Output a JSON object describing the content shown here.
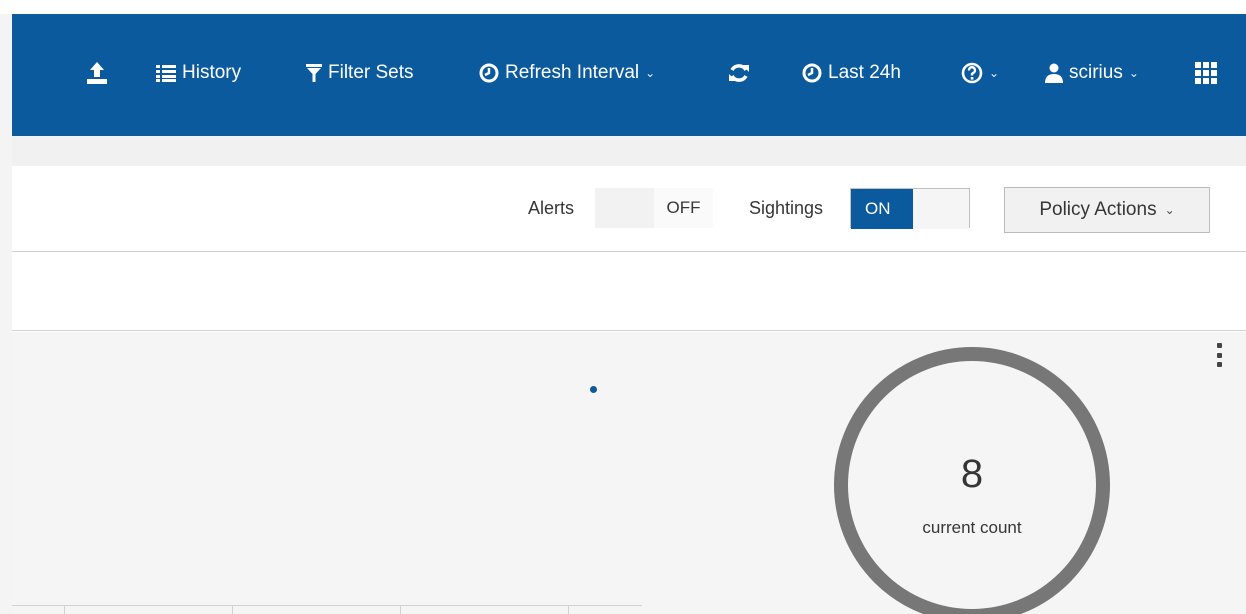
{
  "topbar": {
    "history_label": "History",
    "filter_sets_label": "Filter Sets",
    "refresh_interval_label": "Refresh Interval",
    "time_range_label": "Last 24h",
    "user_label": "scirius",
    "background_color": "#0b5a9e"
  },
  "toolbar": {
    "alerts_label": "Alerts",
    "alerts_state": "OFF",
    "sightings_label": "Sightings",
    "sightings_state": "ON",
    "policy_actions_label": "Policy Actions"
  },
  "widget": {
    "count_value": "8",
    "count_label": "current count"
  },
  "icons": [
    "upload-icon",
    "list-icon",
    "filter-icon",
    "clock-icon",
    "refresh-icon",
    "help-icon",
    "user-icon",
    "apps-grid-icon",
    "kebab-menu-icon"
  ]
}
